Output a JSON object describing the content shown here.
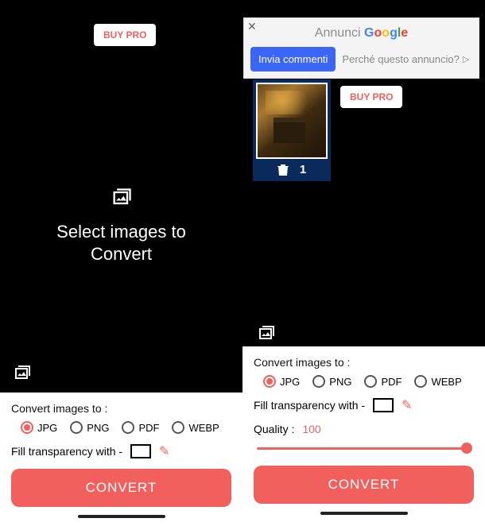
{
  "common": {
    "buy_pro": "BUY PRO",
    "convert_btn": "CONVERT",
    "convert_label": "Convert images to :",
    "fill_label": "Fill transparency with -",
    "formats": [
      "JPG",
      "PNG",
      "PDF",
      "WEBP"
    ],
    "selected_format": "JPG",
    "fill_color": "#ffffff"
  },
  "left": {
    "select_line1": "Select images to",
    "select_line2": "Convert"
  },
  "right": {
    "ad": {
      "brand_prefix": "Annunci ",
      "send_btn": "Invia commenti",
      "why": "Perché questo annuncio?"
    },
    "thumb": {
      "count": "1"
    },
    "quality_label": "Quality :",
    "quality_value": "100"
  }
}
